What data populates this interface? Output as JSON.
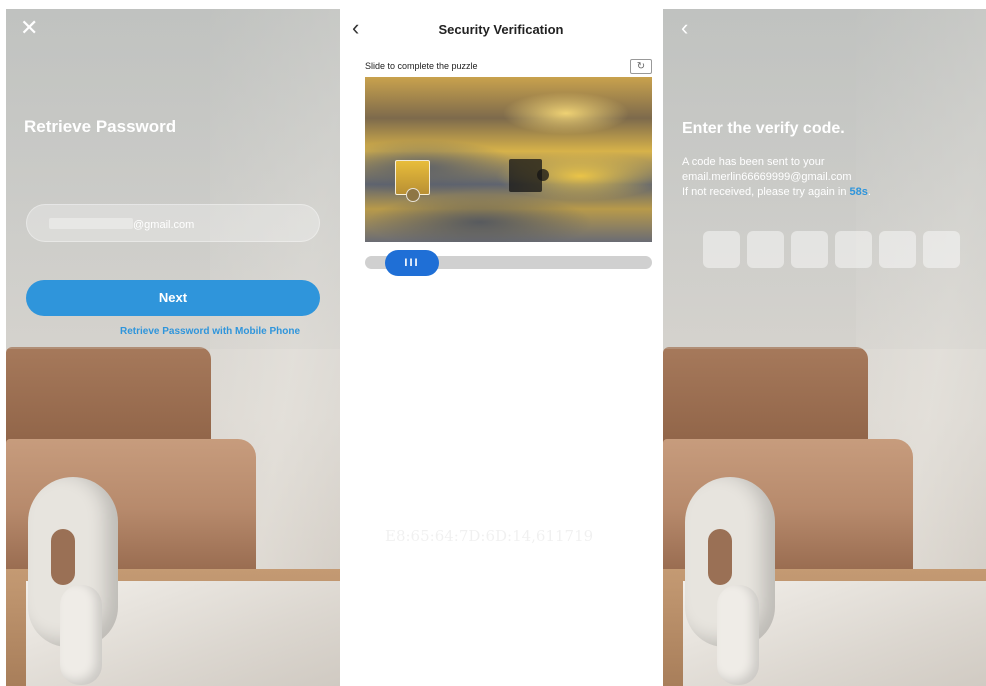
{
  "screen1": {
    "title": "Retrieve Password",
    "email_value_visible": "@gmail.com",
    "next_label": "Next",
    "alt_link": "Retrieve Password with Mobile Phone"
  },
  "screen2": {
    "title": "Security Verification",
    "hint": "Slide to complete the puzzle",
    "refresh_icon": "↻",
    "slider_glyph": "III",
    "watermark": "E8:65:64:7D:6D:14,611719"
  },
  "screen3": {
    "title": "Enter the verify code.",
    "line1": "A code has been sent to your",
    "line2": "email.merlin66669999@gmail.com",
    "line3_prefix": "If not received, please try again in ",
    "countdown": "58s",
    "line3_suffix": ".",
    "code_length": 6
  },
  "colors": {
    "accent": "#2f95db",
    "slider": "#1f6fd6"
  }
}
